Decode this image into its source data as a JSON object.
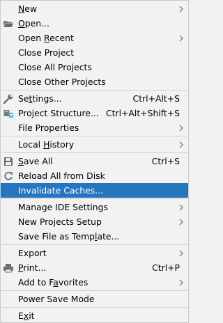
{
  "menu": {
    "items": {
      "new": {
        "pre": "",
        "mn": "N",
        "post": "ew"
      },
      "open": {
        "pre": "",
        "mn": "O",
        "post": "pen..."
      },
      "open_recent": {
        "pre": "Open ",
        "mn": "R",
        "post": "ecent"
      },
      "close_project": {
        "pre": "Close Project",
        "mn": "",
        "post": ""
      },
      "close_all_projects": {
        "pre": "Close All Projects",
        "mn": "",
        "post": ""
      },
      "close_other_projects": {
        "pre": "Close Other Projects",
        "mn": "",
        "post": ""
      },
      "settings": {
        "pre": "Se",
        "mn": "t",
        "post": "tings...",
        "shortcut": "Ctrl+Alt+S"
      },
      "project_structure": {
        "pre": "Project Structure...",
        "mn": "",
        "post": "",
        "shortcut": "Ctrl+Alt+Shift+S"
      },
      "file_properties": {
        "pre": "File Properties",
        "mn": "",
        "post": ""
      },
      "local_history": {
        "pre": "Local ",
        "mn": "H",
        "post": "istory"
      },
      "save_all": {
        "pre": "",
        "mn": "S",
        "post": "ave All",
        "shortcut": "Ctrl+S"
      },
      "reload_all": {
        "pre": "Reload All from Disk",
        "mn": "",
        "post": ""
      },
      "invalidate_caches": {
        "pre": "Invalidate Caches...",
        "mn": "",
        "post": ""
      },
      "manage_ide_settings": {
        "pre": "Manage IDE Settings",
        "mn": "",
        "post": ""
      },
      "new_projects_setup": {
        "pre": "New Projects Setup",
        "mn": "",
        "post": ""
      },
      "save_file_as_template": {
        "pre": "Save File as Temp",
        "mn": "l",
        "post": "ate..."
      },
      "export": {
        "pre": "Export",
        "mn": "",
        "post": ""
      },
      "print": {
        "pre": "",
        "mn": "P",
        "post": "rint...",
        "shortcut": "Ctrl+P"
      },
      "add_to_favorites": {
        "pre": "Add to F",
        "mn": "a",
        "post": "vorites"
      },
      "power_save_mode": {
        "pre": "Power Save Mode",
        "mn": "",
        "post": ""
      },
      "exit": {
        "pre": "E",
        "mn": "x",
        "post": "it"
      }
    }
  },
  "colors": {
    "background": "#f2f2f2",
    "selection": "#2675bf",
    "separator": "#cfcfcf",
    "text": "#000000",
    "shortcut_text": "#000000"
  }
}
